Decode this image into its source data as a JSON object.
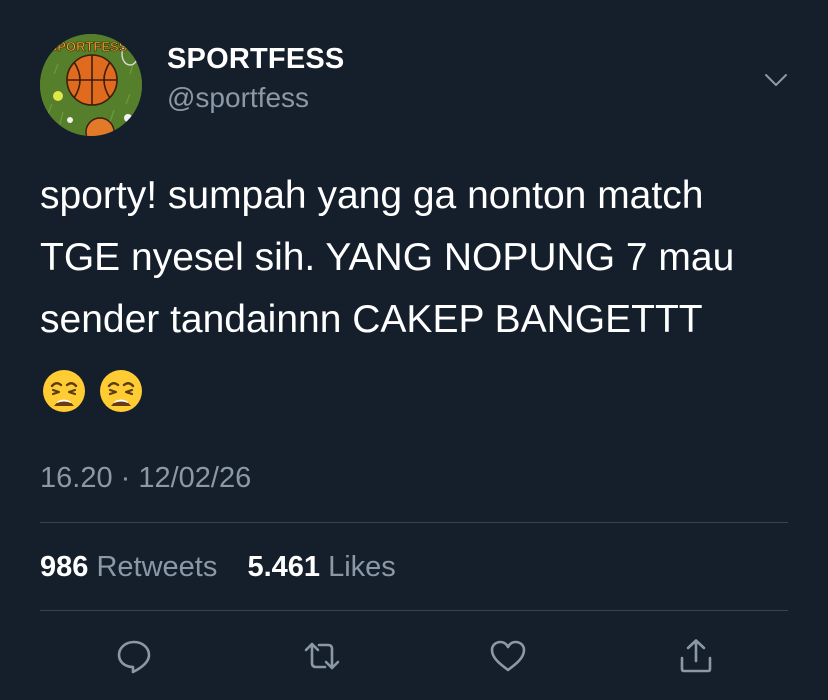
{
  "profile": {
    "display_name": "SPORTFESS",
    "handle": "@sportfess",
    "avatar_text": "SPORTFESS"
  },
  "tweet": {
    "lines": [
      "sporty! sumpah yang ga nonton match",
      "TGE nyesel sih. YANG NOPUNG 7 mau",
      "sender tandainnn CAKEP BANGETTT"
    ],
    "emojis": [
      "weary-face-icon",
      "weary-face-icon"
    ],
    "timestamp": "16.20 · 12/02/26"
  },
  "stats": {
    "retweets_count": "986",
    "retweets_label": "Retweets",
    "likes_count": "5.461",
    "likes_label": "Likes"
  },
  "actions": [
    "reply-icon",
    "retweet-icon",
    "like-icon",
    "share-icon"
  ],
  "colors": {
    "background": "#151f2b",
    "primary_text": "#ffffff",
    "secondary_text": "#8b98a5",
    "divider": "#38444d"
  }
}
